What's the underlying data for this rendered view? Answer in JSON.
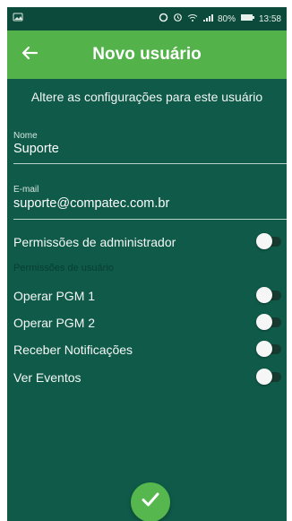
{
  "status_bar": {
    "battery": "80%",
    "time": "13:58",
    "icons": [
      "gallery-icon",
      "circle-icon",
      "alarm-icon",
      "wifi-icon",
      "signal-icon",
      "battery-icon"
    ]
  },
  "header": {
    "title": "Novo usuário",
    "back_icon": "arrow-left-icon"
  },
  "subtitle": "Altere as configurações para este usuário",
  "form": {
    "name": {
      "label": "Nome",
      "value": "Suporte"
    },
    "email": {
      "label": "E-mail",
      "value": "suporte@compatec.com.br"
    }
  },
  "admin_permissions": {
    "label": "Permissões de administrador",
    "enabled": false
  },
  "user_permissions": {
    "section_label": "Permissões de usuário",
    "items": [
      {
        "label": "Operar PGM 1",
        "enabled": false
      },
      {
        "label": "Operar PGM 2",
        "enabled": false
      },
      {
        "label": "Receber Notificações",
        "enabled": false
      },
      {
        "label": "Ver Eventos",
        "enabled": false
      }
    ]
  },
  "actions": {
    "confirm_icon": "checkmark-icon",
    "confirm_color": "#55b74d"
  },
  "colors": {
    "app_bar": "#53b34a",
    "background": "#0f5a48",
    "status_bar": "#0c4a3b"
  }
}
